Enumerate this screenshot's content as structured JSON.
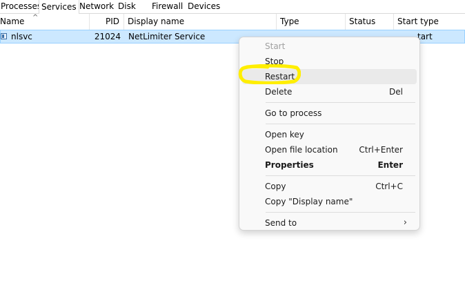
{
  "tabs": [
    "Processes",
    "Services",
    "Network",
    "Disk",
    "Firewall",
    "Devices"
  ],
  "columns": {
    "name": "Name",
    "pid": "PID",
    "display_name": "Display name",
    "type": "Type",
    "status": "Status",
    "start_type": "Start type"
  },
  "service_row": {
    "name": "nlsvc",
    "pid": "21024",
    "display_name": "NetLimiter Service",
    "start_type_partial": "tart"
  },
  "context_menu": {
    "start": "Start",
    "stop": "Stop",
    "restart": "Restart",
    "delete": "Delete",
    "delete_shortcut": "Del",
    "go_to_process": "Go to process",
    "open_key": "Open key",
    "open_file_location": "Open file location",
    "open_file_location_shortcut": "Ctrl+Enter",
    "properties": "Properties",
    "properties_shortcut": "Enter",
    "copy": "Copy",
    "copy_shortcut": "Ctrl+C",
    "copy_display_name": "Copy \"Display name\"",
    "send_to": "Send to"
  },
  "colors": {
    "selection": "#cce8ff",
    "highlight_marker": "#ffee00"
  }
}
